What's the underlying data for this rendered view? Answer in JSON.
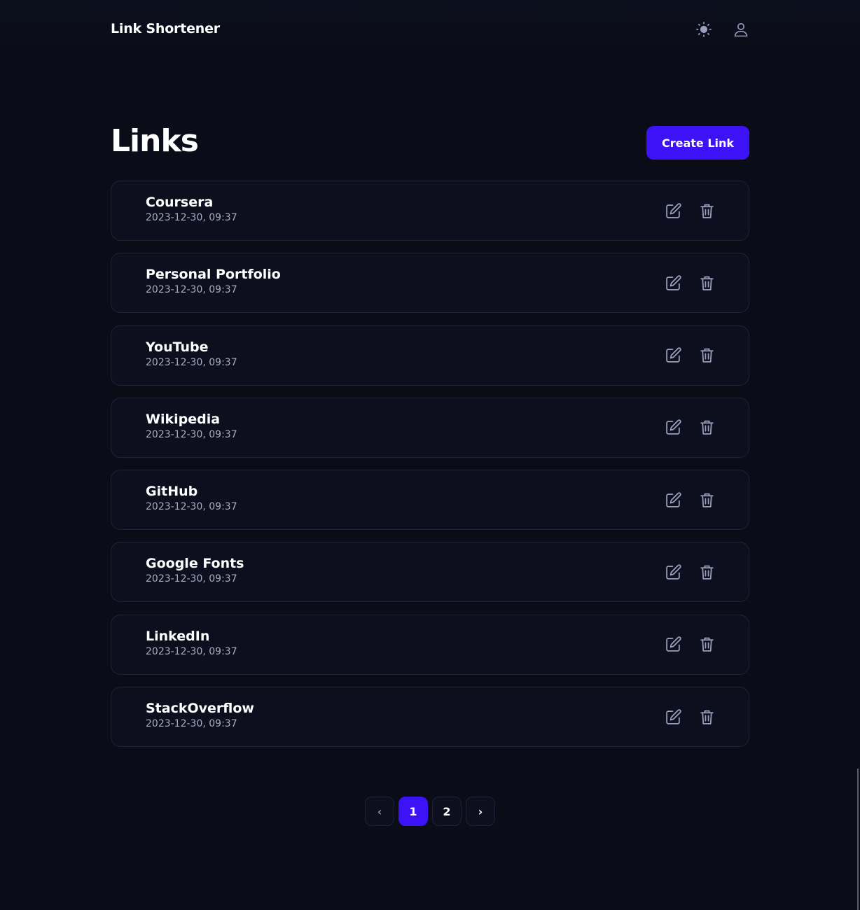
{
  "header": {
    "brand": "Link Shortener",
    "theme_icon": "sun-icon",
    "user_icon": "user-icon"
  },
  "main": {
    "title": "Links",
    "create_button": "Create Link"
  },
  "links": [
    {
      "name": "Coursera",
      "date": "2023-12-30, 09:37"
    },
    {
      "name": "Personal Portfolio",
      "date": "2023-12-30, 09:37"
    },
    {
      "name": "YouTube",
      "date": "2023-12-30, 09:37"
    },
    {
      "name": "Wikipedia",
      "date": "2023-12-30, 09:37"
    },
    {
      "name": "GitHub",
      "date": "2023-12-30, 09:37"
    },
    {
      "name": "Google Fonts",
      "date": "2023-12-30, 09:37"
    },
    {
      "name": "LinkedIn",
      "date": "2023-12-30, 09:37"
    },
    {
      "name": "StackOverflow",
      "date": "2023-12-30, 09:37"
    }
  ],
  "pagination": {
    "prev": "‹",
    "pages": [
      "1",
      "2"
    ],
    "current": "1",
    "next": "›"
  },
  "colors": {
    "background": "#0a0c17",
    "card": "#0d0f1e",
    "accent": "#3d12f6",
    "muted_text": "#a8adc4",
    "icon": "#9a9fbd"
  }
}
